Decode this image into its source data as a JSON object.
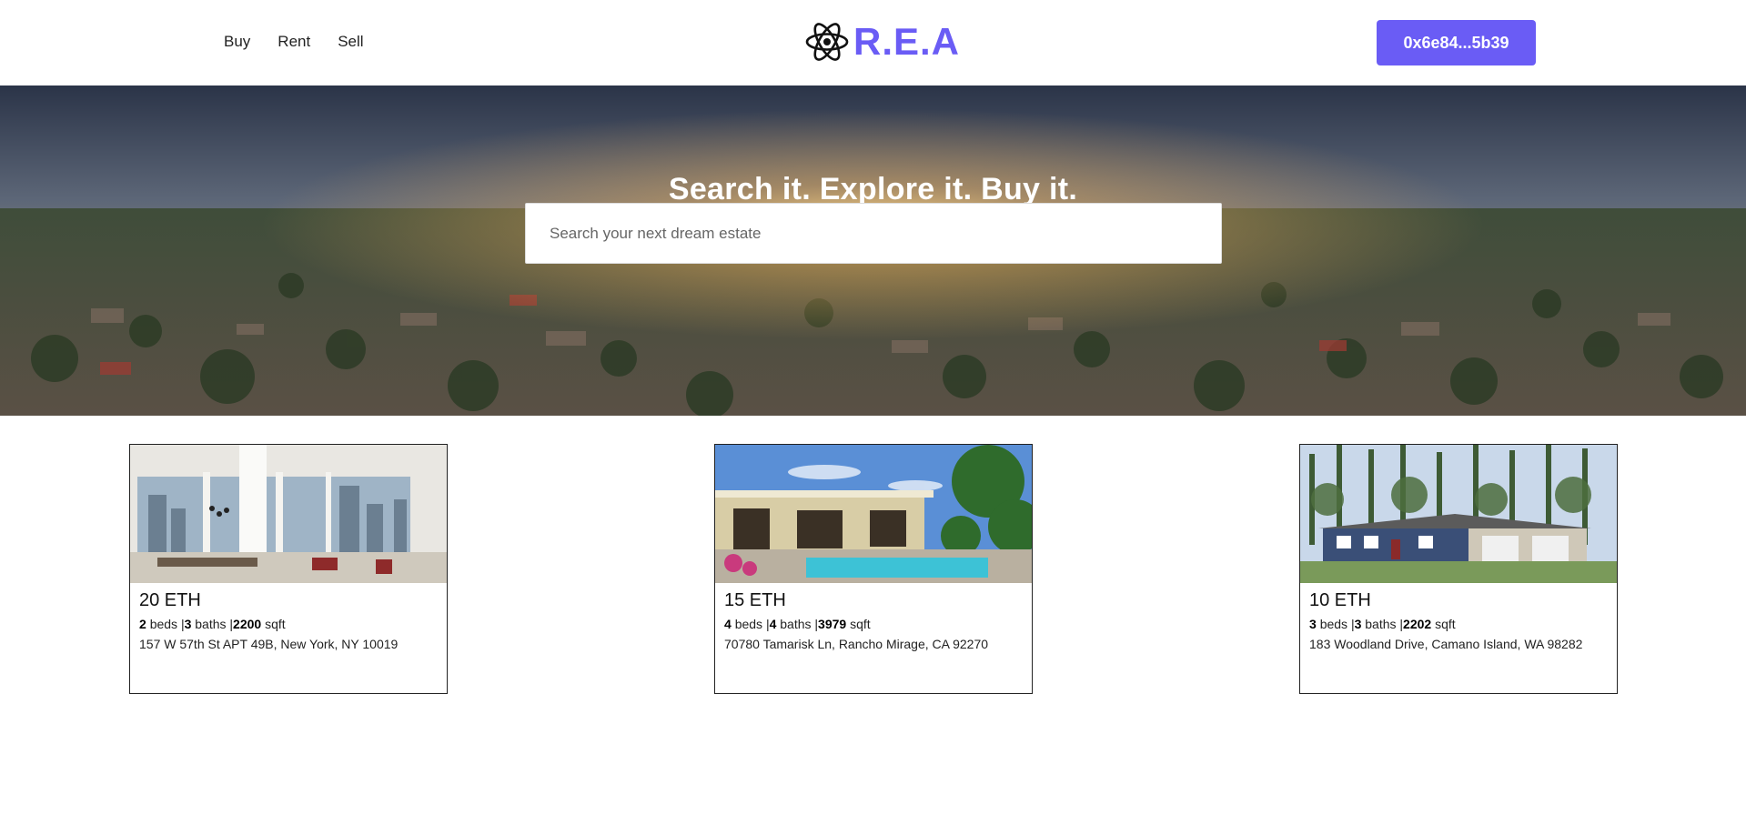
{
  "nav": {
    "links": [
      "Buy",
      "Rent",
      "Sell"
    ],
    "brand": "R.E.A",
    "wallet": "0x6e84...5b39"
  },
  "hero": {
    "title": "Search it. Explore it. Buy it.",
    "search_placeholder": "Search your next dream estate"
  },
  "listings": [
    {
      "price": "20 ETH",
      "beds": "2",
      "baths": "3",
      "sqft": "2200",
      "address": "157 W 57th St APT 49B, New York, NY 10019"
    },
    {
      "price": "15 ETH",
      "beds": "4",
      "baths": "4",
      "sqft": "3979",
      "address": "70780 Tamarisk Ln, Rancho Mirage, CA 92270"
    },
    {
      "price": "10 ETH",
      "beds": "3",
      "baths": "3",
      "sqft": "2202",
      "address": "183 Woodland Drive, Camano Island, WA 98282"
    }
  ],
  "labels": {
    "beds": "beds",
    "baths": "baths",
    "sqft": "sqft",
    "sep": "|"
  },
  "colors": {
    "accent": "#6a5cf5"
  }
}
